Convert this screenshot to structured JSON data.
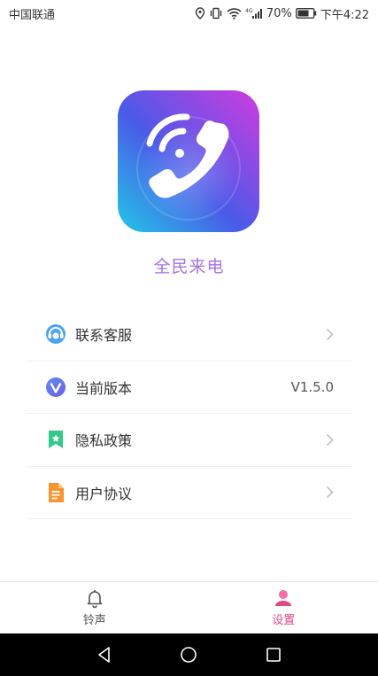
{
  "status_bar": {
    "carrier": "中国联通",
    "battery": "70%",
    "time": "下午4:22"
  },
  "app": {
    "name": "全民来电"
  },
  "menu": [
    {
      "label": "联系客服",
      "value": "",
      "icon": "customer-service-icon"
    },
    {
      "label": "当前版本",
      "value": "V1.5.0",
      "icon": "version-icon"
    },
    {
      "label": "隐私政策",
      "value": "",
      "icon": "privacy-bookmark-icon"
    },
    {
      "label": "用户协议",
      "value": "",
      "icon": "document-icon"
    }
  ],
  "tabs": [
    {
      "label": "铃声",
      "icon": "bell-icon",
      "active": false
    },
    {
      "label": "设置",
      "icon": "user-settings-icon",
      "active": true
    }
  ],
  "colors": {
    "accent_purple": "#a870e8",
    "active_tab": "#e0468a",
    "text": "#333333"
  }
}
